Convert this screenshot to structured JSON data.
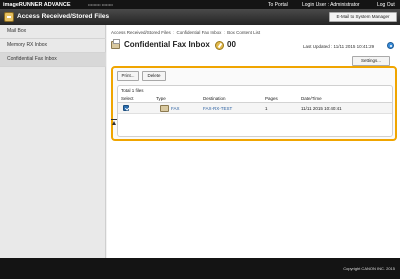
{
  "topbar": {
    "brand": "imageRUNNER ADVANCE",
    "machine": "••••••••• ••••••••",
    "to_portal": "To Portal",
    "login_user": "Login User : Administrator",
    "logout": "Log Out"
  },
  "titlebar": {
    "title": "Access Received/Stored Files",
    "email_button": "E-Mail to System Manager"
  },
  "sidebar": {
    "items": [
      {
        "label": "Mail Box"
      },
      {
        "label": "Memory RX Inbox"
      },
      {
        "label": "Confidential Fax Inbox"
      }
    ]
  },
  "breadcrumb": {
    "parts": [
      "Access Received/Stored Files",
      "Confidential Fax Inbox",
      "Box Content List"
    ]
  },
  "heading": {
    "title": "Confidential Fax Inbox",
    "box_number": "00",
    "updated": "Last Updated : 11/11 2015 10:41:29"
  },
  "settings_button": "Settings...",
  "toolbar": {
    "print": "Print...",
    "delete": "Delete"
  },
  "table": {
    "total": "Total 1 files",
    "columns": {
      "select": "Select",
      "type": "Type",
      "destination": "Destination",
      "pages": "Pages",
      "datetime": "Date/Time"
    },
    "rows": [
      {
        "selected": true,
        "type": "FAX",
        "destination": "FAX-RX-TEST",
        "pages": "1",
        "datetime": "11/11 2015 10:40:41"
      }
    ]
  },
  "footer": {
    "copyright": "Copyright CANON INC. 2015"
  },
  "colors": {
    "highlight": "#f0a500",
    "link": "#2a5fa0",
    "topbar": "#141414"
  }
}
